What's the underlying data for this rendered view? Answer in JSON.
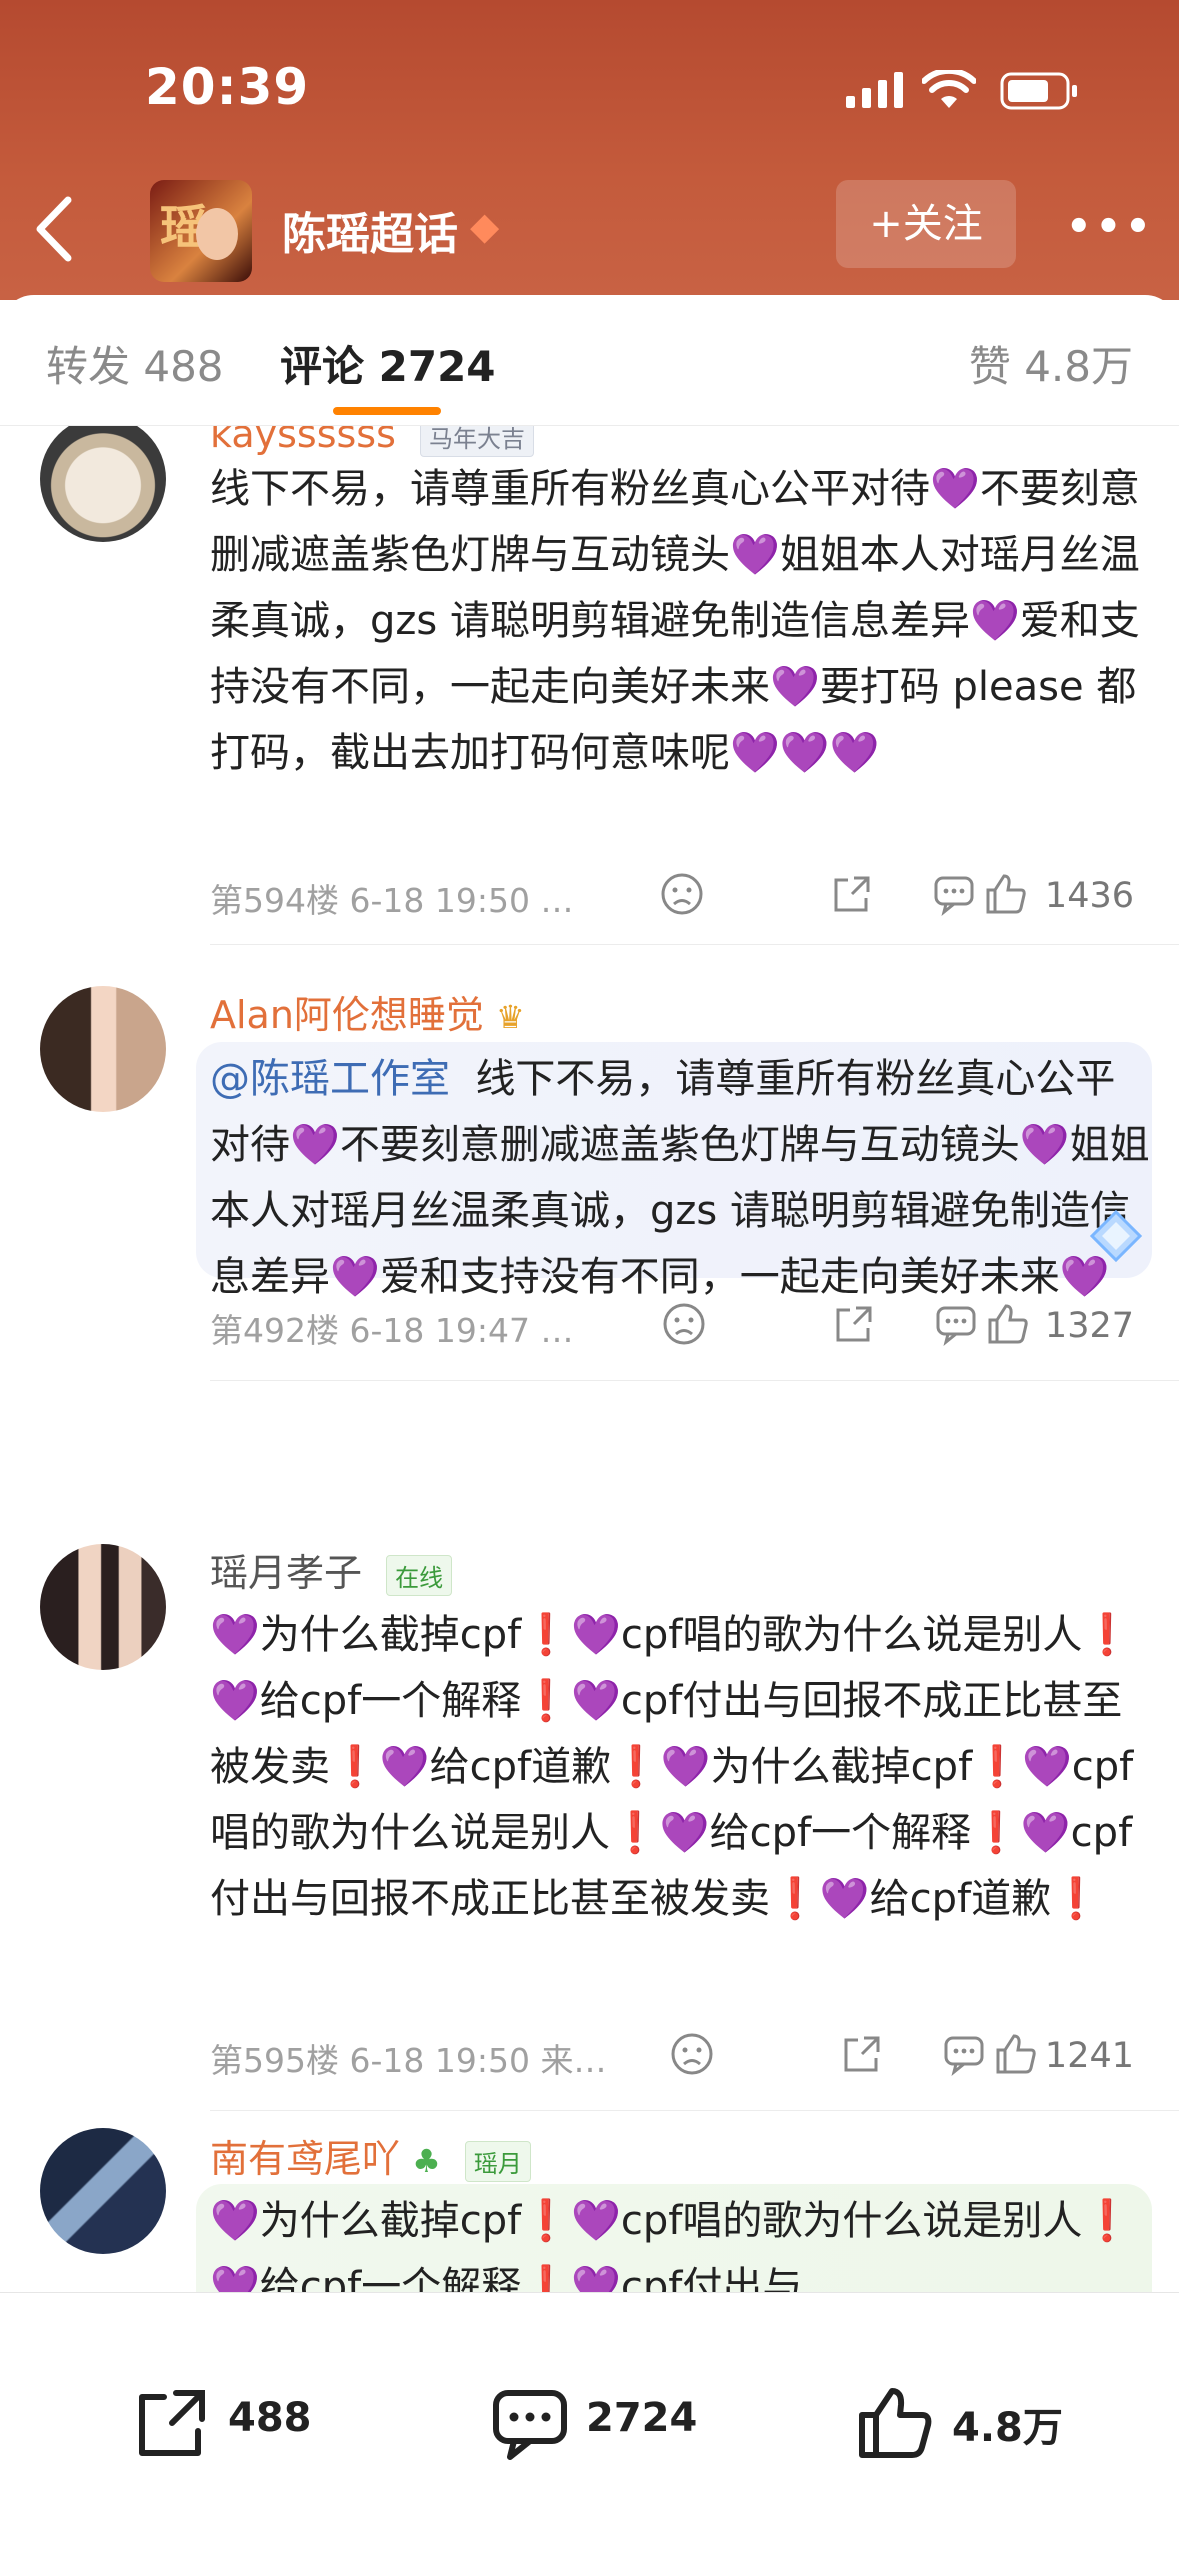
{
  "status_bar": {
    "time": "20:39"
  },
  "header": {
    "title": "陈瑶超话",
    "follow_label": "+关注"
  },
  "tabs": {
    "repost": "转发 488",
    "comments": "评论 2724",
    "likes": "赞 4.8万"
  },
  "comments": [
    {
      "username": "kayssssss",
      "badge": "马年大吉",
      "text_parts": [
        "线下不易，请尊重所有粉丝真心公平对待",
        "💜",
        "不要刻意删减遮盖紫色灯牌与互动镜头",
        "💜",
        "姐姐本人对瑶月丝温柔真诚，gzs 请聪明剪辑避免制造信息差异",
        "💜",
        "爱和支持没有不同，一起走向美好未来",
        "💜",
        "要打码 please 都打码，截出去加打码何意味呢",
        "💜💜💜"
      ],
      "meta": "第594楼 6-18 19:50 …",
      "likes": "1436"
    },
    {
      "username": "Alan阿伦想睡觉",
      "mention": "@陈瑶工作室",
      "text_parts": [
        "线下不易，请尊重所有粉丝真心公平对待",
        "💜",
        "不要刻意删减遮盖紫色灯牌与互动镜头",
        "💜",
        "姐姐本人对瑶月丝温柔真诚，gzs 请聪明剪辑避免制造信息差异",
        "💜",
        "爱和支持没有不同，一起走向美好未来",
        "💜"
      ],
      "meta": "第492楼 6-18 19:47 …",
      "likes": "1327"
    },
    {
      "username": "瑶月孝子",
      "badge": "在线",
      "text": "💜为什么截掉cpf❗💜cpf唱的歌为什么说是别人❗💜给cpf一个解释❗💜cpf付出与回报不成正比甚至被发卖❗💜给cpf道歉❗💜为什么截掉cpf❗💜cpf唱的歌为什么说是别人❗💜给cpf一个解释❗💜cpf付出与回报不成正比甚至被发卖❗💜给cpf道歉❗",
      "meta": "第595楼 6-18 19:50 来…",
      "likes": "1241"
    },
    {
      "username": "南有鸢尾吖",
      "badge": "瑶月",
      "text": "💜为什么截掉cpf❗💜cpf唱的歌为什么说是别人❗💜给cpf一个解释❗💜cpf付出与"
    }
  ],
  "bottom_bar": {
    "reposts": "488",
    "comments": "2724",
    "likes": "4.8万"
  },
  "colors": {
    "header_bg": "#c45b3c",
    "accent": "#ff8200",
    "username": "#e2703a",
    "heart": "#8a3ed6"
  }
}
